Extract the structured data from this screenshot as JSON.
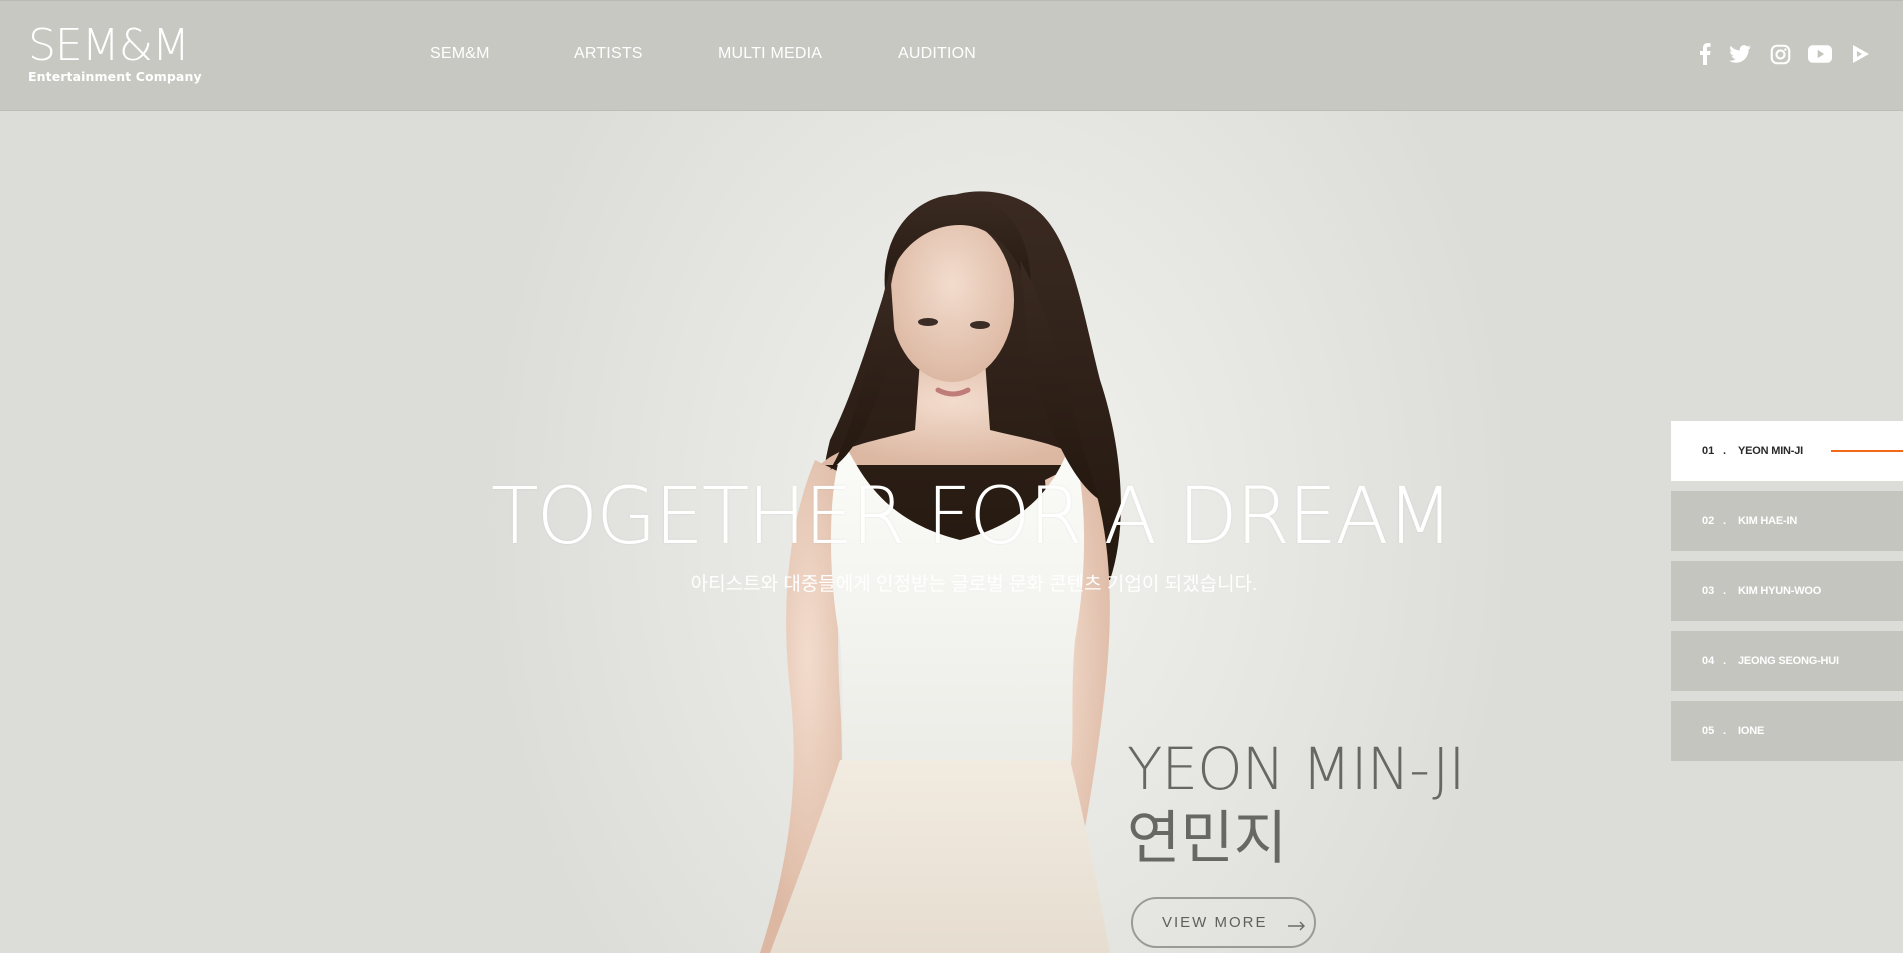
{
  "brand": {
    "logo_main": "SEM&M",
    "logo_sub": "Entertainment Company"
  },
  "nav": {
    "items": [
      {
        "label": "SEM&M"
      },
      {
        "label": "ARTISTS"
      },
      {
        "label": "MULTI MEDIA"
      },
      {
        "label": "AUDITION"
      }
    ]
  },
  "social": [
    {
      "icon": "facebook-icon"
    },
    {
      "icon": "twitter-icon"
    },
    {
      "icon": "instagram-icon"
    },
    {
      "icon": "youtube-icon"
    },
    {
      "icon": "naver-tv-icon"
    }
  ],
  "hero": {
    "title": "TOGETHER FOR A DREAM",
    "subtitle": "아티스트와 대중들에게 인정받는 글로벌 문화 콘텐츠 기업이 되겠습니다."
  },
  "featured": {
    "name_en": "YEON MIN-JI",
    "name_ko": "연민지",
    "view_more": "VIEW MORE"
  },
  "slides": [
    {
      "num": "01",
      "dot": ".",
      "name": "YEON MIN-JI",
      "active": true
    },
    {
      "num": "02",
      "dot": ".",
      "name": "KIM HAE-IN",
      "active": false
    },
    {
      "num": "03",
      "dot": ".",
      "name": "KIM HYUN-WOO",
      "active": false
    },
    {
      "num": "04",
      "dot": ".",
      "name": "JEONG SEONG-HUI",
      "active": false
    },
    {
      "num": "05",
      "dot": ".",
      "name": "IONE",
      "active": false
    }
  ],
  "colors": {
    "header_bg": "#c4c5bf",
    "accent": "#f06a1a",
    "text_dark": "#676764"
  }
}
